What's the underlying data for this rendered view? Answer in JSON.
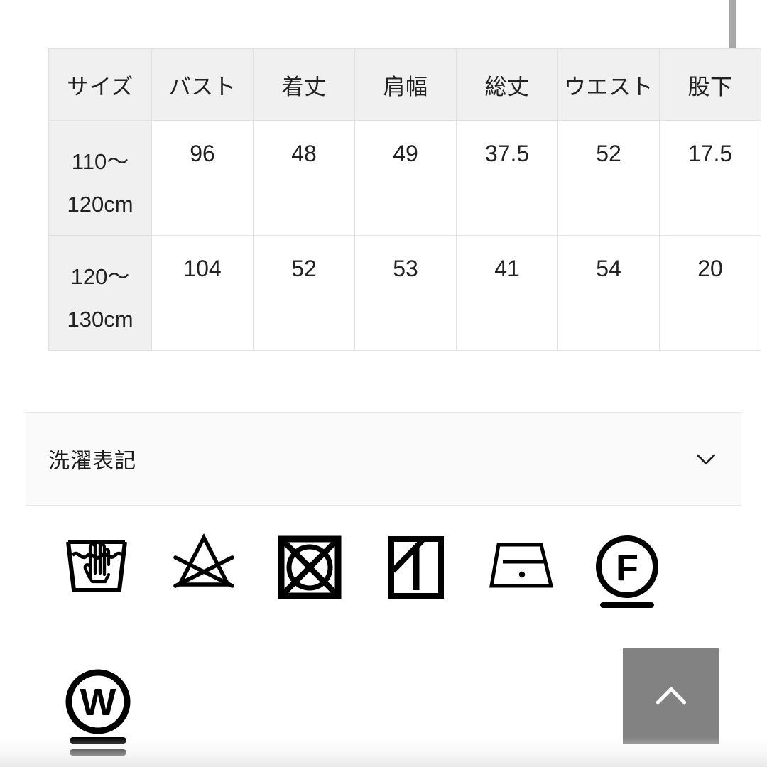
{
  "size_table": {
    "headers": [
      "サイズ",
      "バスト",
      "着丈",
      "肩幅",
      "総丈",
      "ウエスト",
      "股下"
    ],
    "rows": [
      {
        "size": "110〜120cm",
        "values": [
          "96",
          "48",
          "49",
          "37.5",
          "52",
          "17.5"
        ]
      },
      {
        "size": "120〜130cm",
        "values": [
          "104",
          "52",
          "53",
          "41",
          "54",
          "20"
        ]
      }
    ]
  },
  "accordion": {
    "title": "洗濯表記",
    "chevron_icon": "chevron-down-icon",
    "expanded": true
  },
  "care_symbols": {
    "row1": [
      {
        "name": "hand-wash-icon",
        "meaning": "手洗い"
      },
      {
        "name": "do-not-bleach-icon",
        "meaning": "塩素系・酸素系漂白剤の使用禁止"
      },
      {
        "name": "do-not-tumble-dry-icon",
        "meaning": "タンブル乾燥禁止"
      },
      {
        "name": "line-dry-in-shade-icon",
        "meaning": "日陰のつり干し"
      },
      {
        "name": "iron-low-heat-icon",
        "meaning": "低温アイロン"
      },
      {
        "name": "dry-clean-petroleum-gentle-icon",
        "meaning": "石油系ドライクリーニング弱め"
      }
    ],
    "row2": [
      {
        "name": "wet-clean-very-gentle-icon",
        "meaning": "ウエットクリーニング非常に弱め"
      }
    ]
  },
  "scroll_top_button": {
    "icon": "chevron-up-icon",
    "label": "ページ上部へ戻る",
    "background_color": "#828282",
    "icon_color": "#ffffff"
  },
  "scrollbar": {
    "orientation": "vertical",
    "thumb_color": "#a8a8a8"
  },
  "colors": {
    "page_background": "#ffffff",
    "table_header_background": "#f0f0f0",
    "table_border": "#e2e2e2",
    "accordion_background": "#fafafa",
    "text": "#1a1a1a"
  }
}
